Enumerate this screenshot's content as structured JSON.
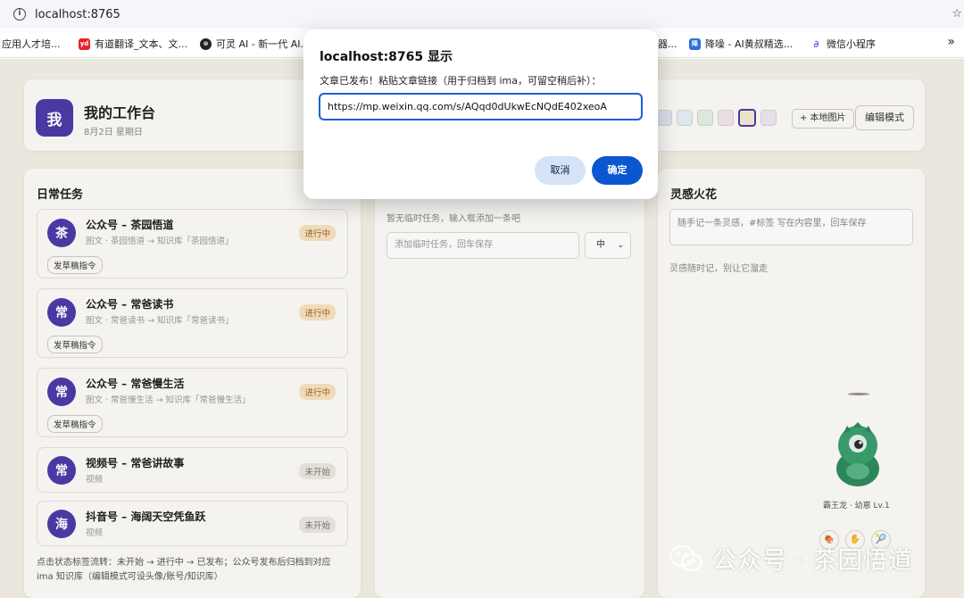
{
  "browser": {
    "url": "localhost:8765",
    "bookmarks": [
      {
        "label": "应用人才培...",
        "icon": "",
        "color": ""
      },
      {
        "label": "有道翻译_文本、文...",
        "icon": "yd",
        "color": "#e3242b"
      },
      {
        "label": "可灵 AI - 新一代 AI...",
        "icon": "kl",
        "color": "#222222"
      },
      {
        "label": "降噪 - AI黄叔精选...",
        "icon": "降",
        "color": "#2b6fe0"
      },
      {
        "label": "微信小程序",
        "icon": "mp",
        "color": "#5b6ef5"
      }
    ],
    "partial_bookmark": "器...",
    "more": "»"
  },
  "header": {
    "avatar_text": "我",
    "title": "我的工作台",
    "date": "8月2日 星期日",
    "swatches": [
      "#dfe7f2",
      "#e6eef6",
      "#e2f0e6",
      "#f1e6ee",
      "#f4ead0",
      "#ece8f2"
    ],
    "local_image_btn": "+ 本地图片",
    "edit_mode_btn": "编辑模式"
  },
  "left": {
    "title": "日常任务",
    "tasks": [
      {
        "avatar": "茶",
        "name": "公众号 – 茶园悟道",
        "sub": "图文 · 茶园悟道 → 知识库「茶园悟道」",
        "status": "进行中",
        "draft": "发草稿指令"
      },
      {
        "avatar": "常",
        "name": "公众号 – 常爸读书",
        "sub": "图文 · 常爸读书 → 知识库「常爸读书」",
        "status": "进行中",
        "draft": "发草稿指令"
      },
      {
        "avatar": "常",
        "name": "公众号 – 常爸慢生活",
        "sub": "图文 · 常爸慢生活 → 知识库「常爸慢生活」",
        "status": "进行中",
        "draft": "发草稿指令"
      },
      {
        "avatar": "常",
        "name": "视频号 – 常爸讲故事",
        "sub": "视频",
        "status": "未开始"
      },
      {
        "avatar": "海",
        "name": "抖音号 – 海阔天空凭鱼跃",
        "sub": "视频",
        "status": "未开始"
      }
    ],
    "tip": "点击状态标签流转：未开始 → 进行中 → 已发布；公众号发布后归档到对应 ima 知识库（编辑模式可设头像/账号/知识库）"
  },
  "middle": {
    "empty_text": "暂无临时任务，输入框添加一条吧",
    "input_placeholder": "添加临时任务，回车保存",
    "priority": "中"
  },
  "right": {
    "title": "灵感火花",
    "input_placeholder": "随手记一条灵感，#标签 写在内容里，回车保存",
    "hint": "灵感随时记，别让它溜走",
    "pet_label": "霸王龙 · 幼崽 Lv.1",
    "pet_items": [
      "🍖",
      "✋",
      "🎾"
    ]
  },
  "dialog": {
    "title": "localhost:8765 显示",
    "message": "文章已发布！粘贴文章链接（用于归档到 ima，可留空稍后补）：",
    "input_value": "https://mp.weixin.qq.com/s/AQqd0dUkwEcNQdE402xeoA",
    "cancel": "取消",
    "ok": "确定"
  },
  "watermark": {
    "text": "公众号 · 茶园悟道"
  }
}
